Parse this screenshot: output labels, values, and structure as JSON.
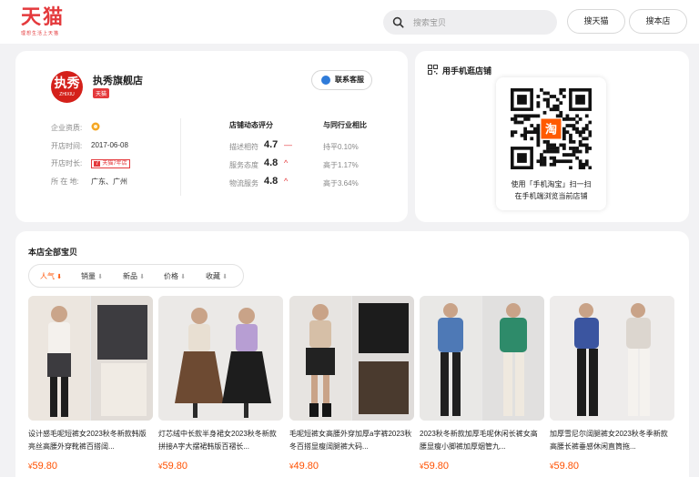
{
  "header": {
    "logo_text": "天猫",
    "logo_subtitle": "理想生活上天猫",
    "search_placeholder": "搜索宝贝",
    "search_tmall_label": "搜天猫",
    "search_store_label": "搜本店"
  },
  "shop": {
    "logo_text": "执秀",
    "logo_subtext": "ZHIXIU",
    "name": "执秀旗舰店",
    "badge": "天猫",
    "service_button": "联系客服",
    "info": [
      {
        "label": "企业资质:",
        "value": ""
      },
      {
        "label": "开店时间:",
        "value": "2017-06-08"
      },
      {
        "label": "开店时长:",
        "value": "天猫7年店",
        "badge_num": "7"
      },
      {
        "label": "所 在 地:",
        "value": "广东、广州"
      }
    ],
    "dynamic_score_title": "店铺动态评分",
    "compare_title": "与同行业相比",
    "scores": [
      {
        "label": "描述相符",
        "value": "4.7",
        "trend": "—",
        "compare": "持平0.10%"
      },
      {
        "label": "服务态度",
        "value": "4.8",
        "trend": "^",
        "compare": "高于1.17%"
      },
      {
        "label": "物流服务",
        "value": "4.8",
        "trend": "^",
        "compare": "高于3.64%"
      }
    ]
  },
  "qr": {
    "title": "用手机逛店铺",
    "center_text": "淘",
    "caption_line1": "使用「手机淘宝」扫一扫",
    "caption_line2": "在手机端浏览当前店铺"
  },
  "products": {
    "section_title": "本店全部宝贝",
    "sort_options": [
      {
        "label": "人气",
        "active": true
      },
      {
        "label": "销量",
        "active": false
      },
      {
        "label": "新品",
        "active": false
      },
      {
        "label": "价格",
        "active": false
      },
      {
        "label": "收藏",
        "active": false
      }
    ],
    "items": [
      {
        "title": "设计感毛呢短裤女2023秋冬新款韩版亮丝高腰外穿靴裤百搭阔...",
        "currency": "¥",
        "price": "59.80"
      },
      {
        "title": "灯芯绒中长款半身裙女2023秋冬新款拼接A字大摆裙韩版百褶长...",
        "currency": "¥",
        "price": "59.80"
      },
      {
        "title": "毛呢短裤女高腰外穿加厚a字裤2023秋冬百搭显瘦阔腿裤大码...",
        "currency": "¥",
        "price": "49.80"
      },
      {
        "title": "2023秋冬新款加厚毛呢休闲长裤女高腰显瘦小脚裤加厚烟管九...",
        "currency": "¥",
        "price": "59.80"
      },
      {
        "title": "加厚雪尼尔阔腿裤女2023秋冬季新款高腰长裤垂感休闲直筒拖...",
        "currency": "¥",
        "price": "59.80"
      }
    ]
  },
  "colors": {
    "tmall_red": "#e4393c",
    "price_orange": "#ff5000",
    "background": "#f2f2f4"
  }
}
